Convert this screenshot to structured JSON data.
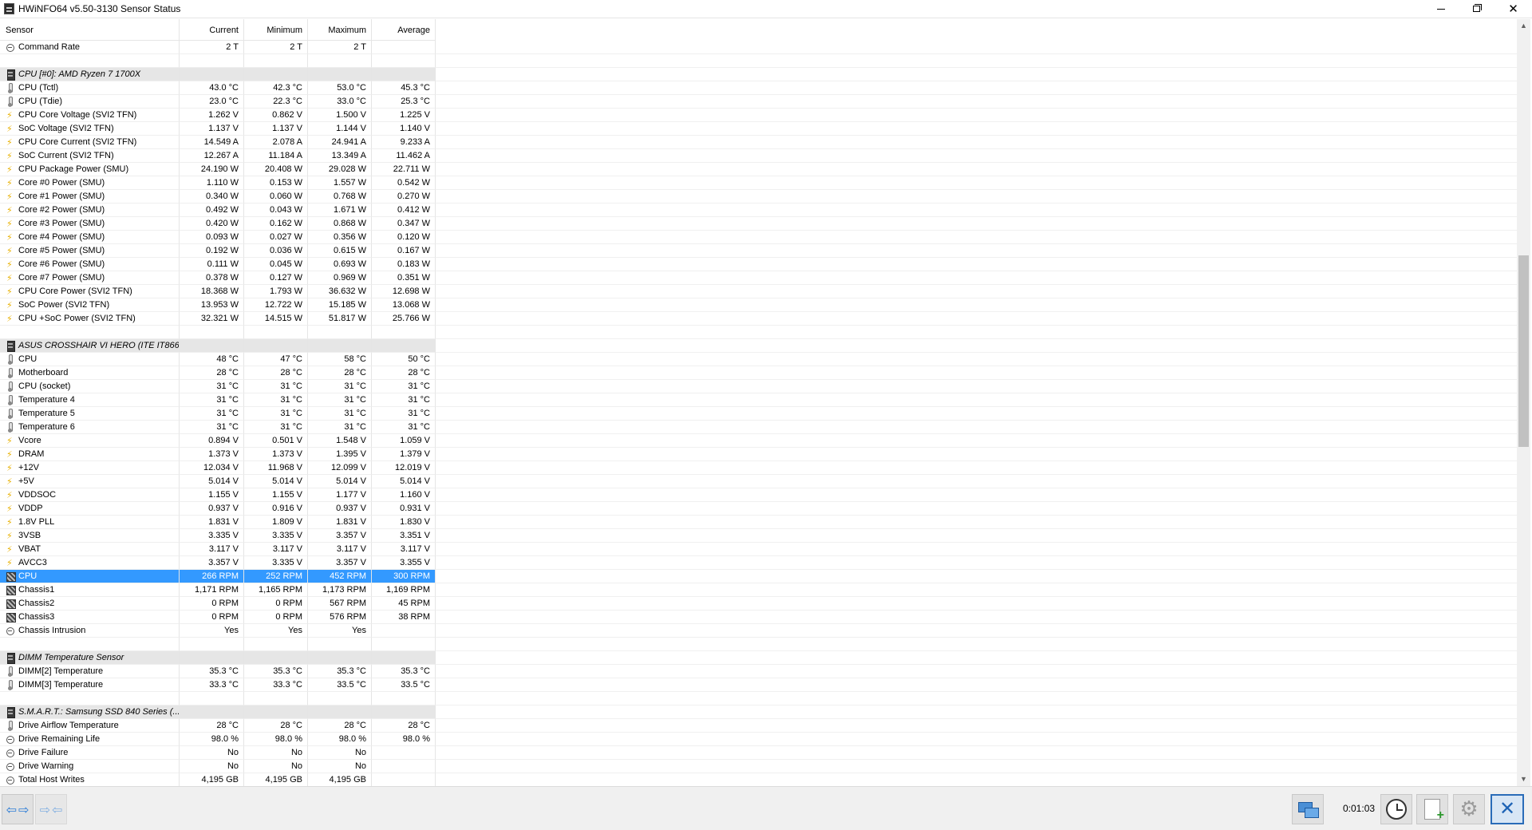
{
  "window": {
    "title": "HWiNFO64 v5.50-3130 Sensor Status",
    "min_glyph": "",
    "close_glyph": "✕"
  },
  "columns": {
    "sensor": "Sensor",
    "current": "Current",
    "minimum": "Minimum",
    "maximum": "Maximum",
    "average": "Average"
  },
  "rows": [
    {
      "type": "data",
      "icon": "clock",
      "name": "Command Rate",
      "cur": "2 T",
      "min": "2 T",
      "max": "2 T",
      "avg": ""
    },
    {
      "type": "blank"
    },
    {
      "type": "group",
      "name": "CPU [#0]: AMD Ryzen 7 1700X"
    },
    {
      "type": "data",
      "icon": "therm",
      "name": "CPU (Tctl)",
      "cur": "43.0 °C",
      "min": "42.3 °C",
      "max": "53.0 °C",
      "avg": "45.3 °C"
    },
    {
      "type": "data",
      "icon": "therm",
      "name": "CPU (Tdie)",
      "cur": "23.0 °C",
      "min": "22.3 °C",
      "max": "33.0 °C",
      "avg": "25.3 °C"
    },
    {
      "type": "data",
      "icon": "volt",
      "name": "CPU Core Voltage (SVI2 TFN)",
      "cur": "1.262 V",
      "min": "0.862 V",
      "max": "1.500 V",
      "avg": "1.225 V"
    },
    {
      "type": "data",
      "icon": "volt",
      "name": "SoC Voltage (SVI2 TFN)",
      "cur": "1.137 V",
      "min": "1.137 V",
      "max": "1.144 V",
      "avg": "1.140 V"
    },
    {
      "type": "data",
      "icon": "volt",
      "name": "CPU Core Current (SVI2 TFN)",
      "cur": "14.549 A",
      "min": "2.078 A",
      "max": "24.941 A",
      "avg": "9.233 A"
    },
    {
      "type": "data",
      "icon": "volt",
      "name": "SoC Current (SVI2 TFN)",
      "cur": "12.267 A",
      "min": "11.184 A",
      "max": "13.349 A",
      "avg": "11.462 A"
    },
    {
      "type": "data",
      "icon": "volt",
      "name": "CPU Package Power (SMU)",
      "cur": "24.190 W",
      "min": "20.408 W",
      "max": "29.028 W",
      "avg": "22.711 W"
    },
    {
      "type": "data",
      "icon": "volt",
      "name": "Core #0 Power (SMU)",
      "cur": "1.110 W",
      "min": "0.153 W",
      "max": "1.557 W",
      "avg": "0.542 W"
    },
    {
      "type": "data",
      "icon": "volt",
      "name": "Core #1 Power (SMU)",
      "cur": "0.340 W",
      "min": "0.060 W",
      "max": "0.768 W",
      "avg": "0.270 W"
    },
    {
      "type": "data",
      "icon": "volt",
      "name": "Core #2 Power (SMU)",
      "cur": "0.492 W",
      "min": "0.043 W",
      "max": "1.671 W",
      "avg": "0.412 W"
    },
    {
      "type": "data",
      "icon": "volt",
      "name": "Core #3 Power (SMU)",
      "cur": "0.420 W",
      "min": "0.162 W",
      "max": "0.868 W",
      "avg": "0.347 W"
    },
    {
      "type": "data",
      "icon": "volt",
      "name": "Core #4 Power (SMU)",
      "cur": "0.093 W",
      "min": "0.027 W",
      "max": "0.356 W",
      "avg": "0.120 W"
    },
    {
      "type": "data",
      "icon": "volt",
      "name": "Core #5 Power (SMU)",
      "cur": "0.192 W",
      "min": "0.036 W",
      "max": "0.615 W",
      "avg": "0.167 W"
    },
    {
      "type": "data",
      "icon": "volt",
      "name": "Core #6 Power (SMU)",
      "cur": "0.111 W",
      "min": "0.045 W",
      "max": "0.693 W",
      "avg": "0.183 W"
    },
    {
      "type": "data",
      "icon": "volt",
      "name": "Core #7 Power (SMU)",
      "cur": "0.378 W",
      "min": "0.127 W",
      "max": "0.969 W",
      "avg": "0.351 W"
    },
    {
      "type": "data",
      "icon": "volt",
      "name": "CPU Core Power (SVI2 TFN)",
      "cur": "18.368 W",
      "min": "1.793 W",
      "max": "36.632 W",
      "avg": "12.698 W"
    },
    {
      "type": "data",
      "icon": "volt",
      "name": "SoC Power (SVI2 TFN)",
      "cur": "13.953 W",
      "min": "12.722 W",
      "max": "15.185 W",
      "avg": "13.068 W"
    },
    {
      "type": "data",
      "icon": "volt",
      "name": "CPU +SoC Power (SVI2 TFN)",
      "cur": "32.321 W",
      "min": "14.515 W",
      "max": "51.817 W",
      "avg": "25.766 W"
    },
    {
      "type": "blank"
    },
    {
      "type": "group",
      "name": "ASUS CROSSHAIR VI HERO (ITE IT866..."
    },
    {
      "type": "data",
      "icon": "therm",
      "name": "CPU",
      "cur": "48 °C",
      "min": "47 °C",
      "max": "58 °C",
      "avg": "50 °C"
    },
    {
      "type": "data",
      "icon": "therm",
      "name": "Motherboard",
      "cur": "28 °C",
      "min": "28 °C",
      "max": "28 °C",
      "avg": "28 °C"
    },
    {
      "type": "data",
      "icon": "therm",
      "name": "CPU (socket)",
      "cur": "31 °C",
      "min": "31 °C",
      "max": "31 °C",
      "avg": "31 °C"
    },
    {
      "type": "data",
      "icon": "therm",
      "name": "Temperature 4",
      "cur": "31 °C",
      "min": "31 °C",
      "max": "31 °C",
      "avg": "31 °C"
    },
    {
      "type": "data",
      "icon": "therm",
      "name": "Temperature 5",
      "cur": "31 °C",
      "min": "31 °C",
      "max": "31 °C",
      "avg": "31 °C"
    },
    {
      "type": "data",
      "icon": "therm",
      "name": "Temperature 6",
      "cur": "31 °C",
      "min": "31 °C",
      "max": "31 °C",
      "avg": "31 °C"
    },
    {
      "type": "data",
      "icon": "volt",
      "name": "Vcore",
      "cur": "0.894 V",
      "min": "0.501 V",
      "max": "1.548 V",
      "avg": "1.059 V"
    },
    {
      "type": "data",
      "icon": "volt",
      "name": "DRAM",
      "cur": "1.373 V",
      "min": "1.373 V",
      "max": "1.395 V",
      "avg": "1.379 V"
    },
    {
      "type": "data",
      "icon": "volt",
      "name": "+12V",
      "cur": "12.034 V",
      "min": "11.968 V",
      "max": "12.099 V",
      "avg": "12.019 V"
    },
    {
      "type": "data",
      "icon": "volt",
      "name": "+5V",
      "cur": "5.014 V",
      "min": "5.014 V",
      "max": "5.014 V",
      "avg": "5.014 V"
    },
    {
      "type": "data",
      "icon": "volt",
      "name": "VDDSOC",
      "cur": "1.155 V",
      "min": "1.155 V",
      "max": "1.177 V",
      "avg": "1.160 V"
    },
    {
      "type": "data",
      "icon": "volt",
      "name": "VDDP",
      "cur": "0.937 V",
      "min": "0.916 V",
      "max": "0.937 V",
      "avg": "0.931 V"
    },
    {
      "type": "data",
      "icon": "volt",
      "name": "1.8V PLL",
      "cur": "1.831 V",
      "min": "1.809 V",
      "max": "1.831 V",
      "avg": "1.830 V"
    },
    {
      "type": "data",
      "icon": "volt",
      "name": "3VSB",
      "cur": "3.335 V",
      "min": "3.335 V",
      "max": "3.357 V",
      "avg": "3.351 V"
    },
    {
      "type": "data",
      "icon": "volt",
      "name": "VBAT",
      "cur": "3.117 V",
      "min": "3.117 V",
      "max": "3.117 V",
      "avg": "3.117 V"
    },
    {
      "type": "data",
      "icon": "volt",
      "name": "AVCC3",
      "cur": "3.357 V",
      "min": "3.335 V",
      "max": "3.357 V",
      "avg": "3.355 V"
    },
    {
      "type": "data",
      "icon": "fan",
      "name": "CPU",
      "cur": "266 RPM",
      "min": "252 RPM",
      "max": "452 RPM",
      "avg": "300 RPM",
      "selected": true
    },
    {
      "type": "data",
      "icon": "fan",
      "name": "Chassis1",
      "cur": "1,171 RPM",
      "min": "1,165 RPM",
      "max": "1,173 RPM",
      "avg": "1,169 RPM"
    },
    {
      "type": "data",
      "icon": "fan",
      "name": "Chassis2",
      "cur": "0 RPM",
      "min": "0 RPM",
      "max": "567 RPM",
      "avg": "45 RPM"
    },
    {
      "type": "data",
      "icon": "fan",
      "name": "Chassis3",
      "cur": "0 RPM",
      "min": "0 RPM",
      "max": "576 RPM",
      "avg": "38 RPM"
    },
    {
      "type": "data",
      "icon": "clock",
      "name": "Chassis Intrusion",
      "cur": "Yes",
      "min": "Yes",
      "max": "Yes",
      "avg": ""
    },
    {
      "type": "blank"
    },
    {
      "type": "group",
      "name": "DIMM Temperature Sensor"
    },
    {
      "type": "data",
      "icon": "therm",
      "name": "DIMM[2] Temperature",
      "cur": "35.3 °C",
      "min": "35.3 °C",
      "max": "35.3 °C",
      "avg": "35.3 °C"
    },
    {
      "type": "data",
      "icon": "therm",
      "name": "DIMM[3] Temperature",
      "cur": "33.3 °C",
      "min": "33.3 °C",
      "max": "33.5 °C",
      "avg": "33.5 °C"
    },
    {
      "type": "blank"
    },
    {
      "type": "group",
      "name": "S.M.A.R.T.: Samsung SSD 840 Series (..."
    },
    {
      "type": "data",
      "icon": "therm",
      "name": "Drive Airflow Temperature",
      "cur": "28 °C",
      "min": "28 °C",
      "max": "28 °C",
      "avg": "28 °C"
    },
    {
      "type": "data",
      "icon": "clock",
      "name": "Drive Remaining Life",
      "cur": "98.0 %",
      "min": "98.0 %",
      "max": "98.0 %",
      "avg": "98.0 %"
    },
    {
      "type": "data",
      "icon": "clock",
      "name": "Drive Failure",
      "cur": "No",
      "min": "No",
      "max": "No",
      "avg": ""
    },
    {
      "type": "data",
      "icon": "clock",
      "name": "Drive Warning",
      "cur": "No",
      "min": "No",
      "max": "No",
      "avg": ""
    },
    {
      "type": "data",
      "icon": "clock",
      "name": "Total Host Writes",
      "cur": "4,195 GB",
      "min": "4,195 GB",
      "max": "4,195 GB",
      "avg": ""
    }
  ],
  "toolbar": {
    "timer": "0:01:03"
  },
  "colors": {
    "selection": "#3399ff",
    "group_bg": "#e6e6e6",
    "accent": "#2a7bd6"
  }
}
